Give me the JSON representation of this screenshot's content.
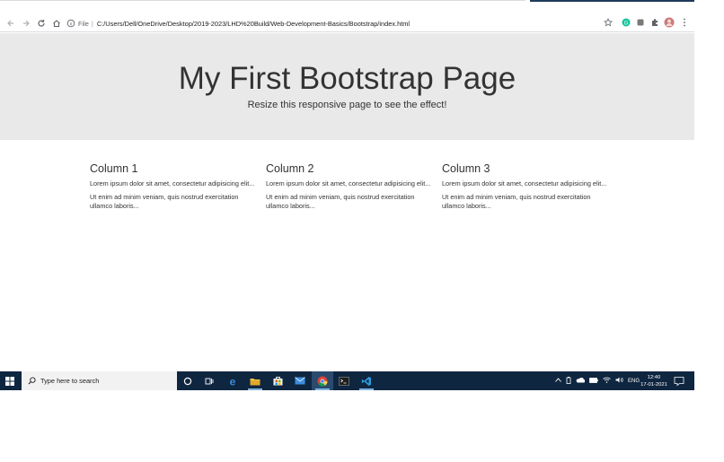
{
  "browser": {
    "file_label": "File",
    "url": "C:/Users/Dell/OneDrive/Desktop/2019-2023/LHD%20Build/Web-Development-Basics/Bootstrap/index.html"
  },
  "jumbotron": {
    "title": "My First Bootstrap Page",
    "subtitle": "Resize this responsive page to see the effect!"
  },
  "columns": [
    {
      "heading": "Column 1",
      "p1": "Lorem ipsum dolor sit amet, consectetur adipisicing elit...",
      "p2": "Ut enim ad minim veniam, quis nostrud exercitation ullamco laboris..."
    },
    {
      "heading": "Column 2",
      "p1": "Lorem ipsum dolor sit amet, consectetur adipisicing elit...",
      "p2": "Ut enim ad minim veniam, quis nostrud exercitation ullamco laboris..."
    },
    {
      "heading": "Column 3",
      "p1": "Lorem ipsum dolor sit amet, consectetur adipisicing elit...",
      "p2": "Ut enim ad minim veniam, quis nostrud exercitation ullamco laboris..."
    }
  ],
  "taskbar": {
    "search_placeholder": "Type here to search",
    "lang": "ENG",
    "time": "12:40",
    "date": "17-01-2021"
  },
  "colors": {
    "jumbotron_bg": "#e9e9e9",
    "taskbar_bg": "#0f2640",
    "text": "#333333"
  }
}
